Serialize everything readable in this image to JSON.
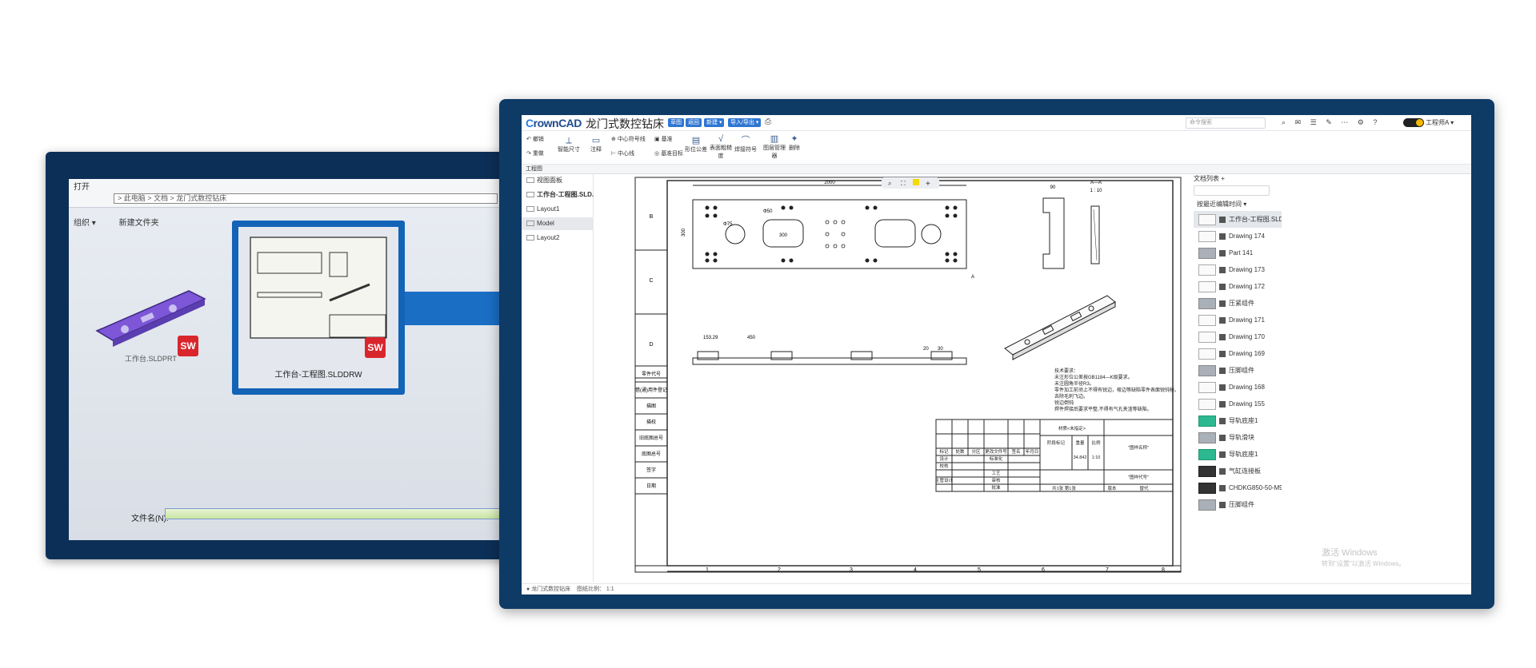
{
  "left_window": {
    "title": "打开",
    "path": "> 此电脑 > 文档 > 龙门式数控钻床",
    "menu": [
      "组织 ▾",
      "新建文件夹"
    ],
    "file_label": "文件名(N):",
    "selected_file": "工作台-工程图.SLDDRW",
    "badge": "SW"
  },
  "app": {
    "logo_prefix": "C",
    "logo_rest": "rownCAD",
    "doc_title": "龙门式数控钻床",
    "title_tag": "草图",
    "pill_a": "返回",
    "pill_b": "新建 ▾",
    "pill_c": "导入/导出 ▾",
    "search_placeholder": "命令搜索",
    "user": "工程师A ▾",
    "toolbar_icons": [
      "⌕",
      "✉",
      "☰",
      "✎",
      "⋯",
      "⚙",
      "?"
    ],
    "ribbon": {
      "undo": "撤销",
      "redo": "重做",
      "smart_dim": "智能尺寸",
      "note": "注释",
      "center_mark": "中心符号线",
      "center_line": "中心线",
      "datum": "基准",
      "datum_target": "基准目标",
      "geo_tol": "形位公差",
      "surface": "表面粗糙度",
      "weld": "焊接符号",
      "layer": "图层管理器",
      "delete": "删除"
    },
    "tab": "工程图",
    "sidebar": {
      "header": "视图面板",
      "doc": "工作台-工程图.SLD...",
      "items": [
        "Layout1",
        "Model",
        "Layout2"
      ]
    },
    "status": {
      "project": "龙门式数控钻床",
      "scale_label": "图纸比例：",
      "scale": "1:1"
    },
    "drawing": {
      "row_labels": [
        "B",
        "C",
        "D"
      ],
      "col_labels": [
        "1",
        "2",
        "3",
        "4",
        "5",
        "6",
        "7",
        "8"
      ],
      "dims": {
        "width": "2000",
        "height": "300",
        "hole_a": "Φ75",
        "hole_b": "Φ50",
        "slot": "300",
        "side_w": "90",
        "side_a": "A—A",
        "side_scale": "1 : 10",
        "len_a": "153.29",
        "len_b": "450",
        "t1": "20",
        "t2": "30"
      },
      "section_mark": "A",
      "notes_title": "技术要求：",
      "notes": [
        "未注形位公差按GB1184—K级要求。",
        "未注圆角半径R3。",
        "零件加工前须上不得有锐边，棱边等缺陷零件表面锐钝棱。",
        "去除毛刺飞边。",
        "锐边倒钝",
        "焊件焊接后要求平整,不得有气孔夹渣等缺陷。"
      ],
      "title_block": {
        "material": "材质<未指定>",
        "labels": [
          "标记",
          "处数",
          "分区",
          "更改文件号",
          "签名",
          "年月日"
        ],
        "roles": [
          "设计",
          "校核",
          "主管设计"
        ],
        "std": "标准化",
        "proc": "工艺",
        "appr": "批准",
        "review": "审核",
        "stage": "阶段标记",
        "weight_label": "重量",
        "ratio_label": "比例",
        "weight": "34.842",
        "ratio": "1:10",
        "name_a": "\"图样名称\"",
        "name_b": "\"图样代号\"",
        "sheet": "共1张  第1张",
        "ver": "版本",
        "replace": "替代"
      },
      "left_table": [
        "零件代号",
        "借(通)用件登记",
        "描图",
        "描校",
        "旧底图总号",
        "底图总号",
        "签字",
        "日期"
      ]
    },
    "right_panel": {
      "header": "文档列表 +",
      "sort": "按最近编辑时间 ▾",
      "items": [
        {
          "name": "工作台-工程图.SLDDR...",
          "thumb": "drawing"
        },
        {
          "name": "Drawing 174",
          "thumb": "drawing"
        },
        {
          "name": "Part 141",
          "thumb": "grey"
        },
        {
          "name": "Drawing 173",
          "thumb": "drawing"
        },
        {
          "name": "Drawing 172",
          "thumb": "drawing"
        },
        {
          "name": "压紧组件",
          "thumb": "grey"
        },
        {
          "name": "Drawing 171",
          "thumb": "drawing"
        },
        {
          "name": "Drawing 170",
          "thumb": "drawing"
        },
        {
          "name": "Drawing 169",
          "thumb": "drawing"
        },
        {
          "name": "压脚组件",
          "thumb": "grey"
        },
        {
          "name": "Drawing 168",
          "thumb": "drawing"
        },
        {
          "name": "Drawing 155",
          "thumb": "drawing"
        },
        {
          "name": "导轨底座1",
          "thumb": "green"
        },
        {
          "name": "导轨滑块",
          "thumb": "grey"
        },
        {
          "name": "导轨底座1",
          "thumb": "green"
        },
        {
          "name": "气缸连接板",
          "thumb": "dark"
        },
        {
          "name": "CHDKG850-50-M9B-...",
          "thumb": "dark"
        },
        {
          "name": "压脚组件",
          "thumb": "grey"
        }
      ]
    },
    "watermark": [
      "激活 Windows",
      "转到\"设置\"以激活 Windows。"
    ]
  }
}
